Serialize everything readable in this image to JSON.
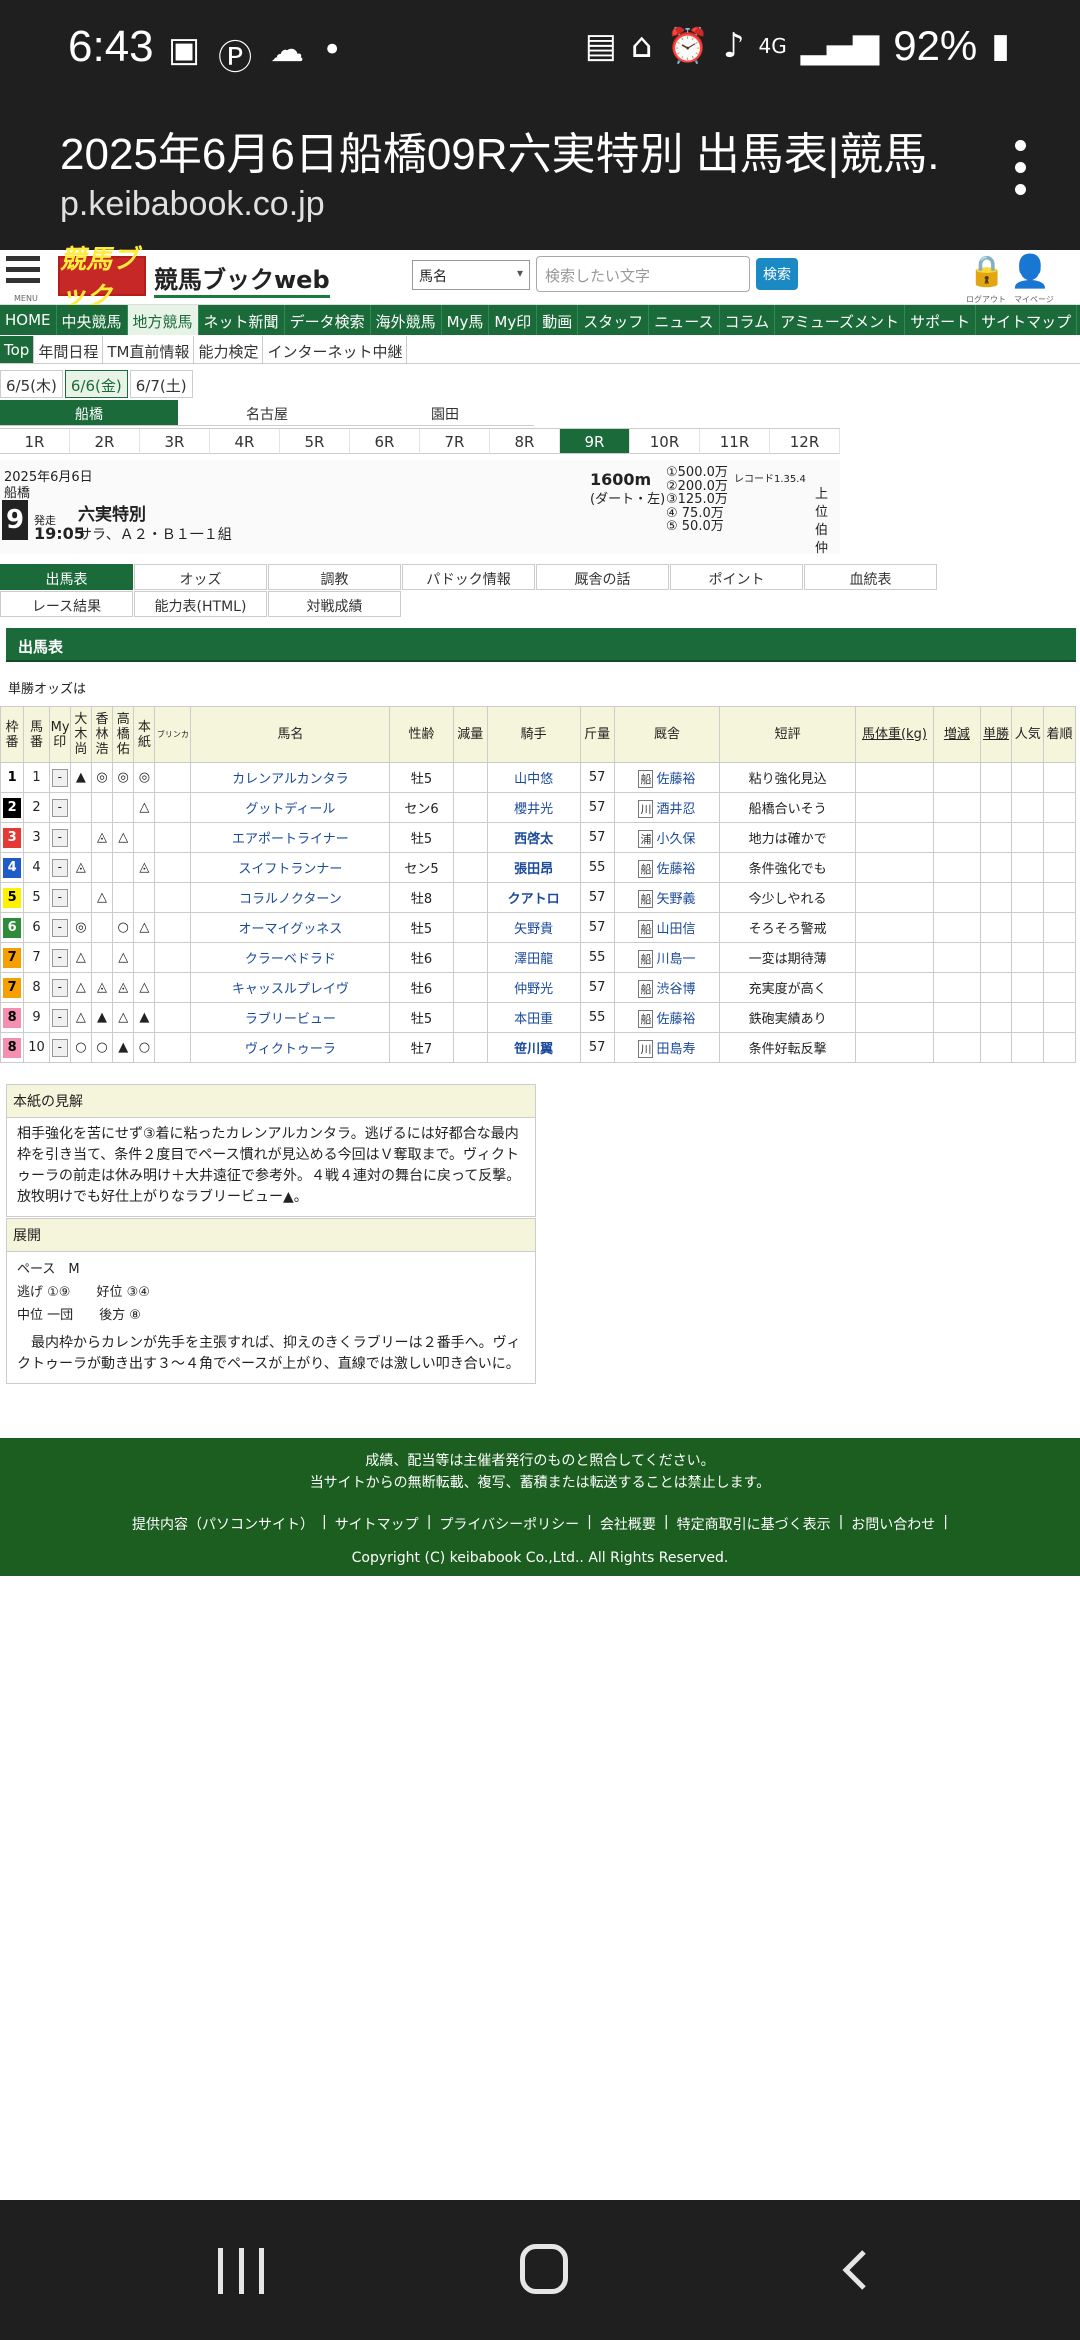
{
  "status": {
    "time": "6:43",
    "battery": "92%",
    "network": "4G"
  },
  "browser": {
    "title": "2025年6月6日船橋09R六実特別 出馬表|競馬...",
    "url": "p.keibabook.co.jp"
  },
  "header": {
    "logo": "競馬ブック",
    "site_name": "競馬ブックweb",
    "search_select": "馬名",
    "search_placeholder": "検索したい文字",
    "search_button": "検索",
    "menu_label": "MENU",
    "logout_label": "ログアウト",
    "mypage_label": "マイページ"
  },
  "nav1": [
    "HOME",
    "中央競馬",
    "地方競馬",
    "ネット新聞",
    "データ検索",
    "海外競馬",
    "My馬",
    "My印",
    "動画",
    "スタッフ",
    "ニュース",
    "コラム",
    "アミューズメント",
    "サポート",
    "サイトマップ"
  ],
  "nav2": [
    "Top",
    "年間日程",
    "TM直前情報",
    "能力検定",
    "インターネット中継"
  ],
  "dates": [
    "6/5(木)",
    "6/6(金)",
    "6/7(土)"
  ],
  "venues": [
    "船橋",
    "名古屋",
    "園田"
  ],
  "races": [
    "1R",
    "2R",
    "3R",
    "4R",
    "5R",
    "6R",
    "7R",
    "8R",
    "9R",
    "10R",
    "11R",
    "12R"
  ],
  "race": {
    "date": "2025年6月6日",
    "venue": "船橋",
    "number": "9",
    "hassou": "発走",
    "time": "19:05",
    "name": "六実特別",
    "class": "サラ、Ａ２・Ｂ１一１組",
    "distance": "1600m",
    "course": "(ダート・左)",
    "prizes": [
      "①500.0万",
      "②200.0万",
      "③125.0万",
      "④ 75.0万",
      "⑤ 50.0万"
    ],
    "record": "レコード1.35.4",
    "side": "上位伯仲"
  },
  "tabs": [
    "出馬表",
    "オッズ",
    "調教",
    "パドック情報",
    "厩舎の話",
    "ポイント",
    "血統表",
    "レース結果",
    "能力表(HTML)",
    "対戦成績"
  ],
  "section_title": "出馬表",
  "odds_note": "単勝オッズは",
  "table": {
    "headers": [
      "枠番",
      "馬番",
      "My印",
      "大木尚",
      "香林浩",
      "高橋佑",
      "本紙",
      "ブリンカ",
      "馬名",
      "性齢",
      "減量",
      "騎手",
      "斤量",
      "厩舎",
      "短評",
      "馬体重(kg)",
      "増減",
      "単勝",
      "人気",
      "着順"
    ],
    "rows": [
      {
        "waku": "1",
        "num": "1",
        "my": "-",
        "m1": "▲",
        "m2": "◎",
        "m3": "◎",
        "m4": "◎",
        "name": "カレンアルカンタラ",
        "sex": "牡5",
        "jockey": "山中悠",
        "weight": "57",
        "area": "船",
        "trainer": "佐藤裕",
        "comment": "粘り強化見込"
      },
      {
        "waku": "2",
        "num": "2",
        "my": "-",
        "m1": "",
        "m2": "",
        "m3": "",
        "m4": "△",
        "name": "グットディール",
        "sex": "セン6",
        "jockey": "櫻井光",
        "weight": "57",
        "area": "川",
        "trainer": "酒井忍",
        "comment": "船橋合いそう"
      },
      {
        "waku": "3",
        "num": "3",
        "my": "-",
        "m1": "",
        "m2": "◬",
        "m3": "△",
        "m4": "",
        "name": "エアポートライナー",
        "sex": "牡5",
        "jockey": "西啓太",
        "weight": "57",
        "area": "浦",
        "trainer": "小久保",
        "comment": "地力は確かで"
      },
      {
        "waku": "4",
        "num": "4",
        "my": "-",
        "m1": "◬",
        "m2": "",
        "m3": "",
        "m4": "◬",
        "name": "スイフトランナー",
        "sex": "セン5",
        "jockey": "張田昂",
        "weight": "55",
        "area": "船",
        "trainer": "佐藤裕",
        "comment": "条件強化でも"
      },
      {
        "waku": "5",
        "num": "5",
        "my": "-",
        "m1": "",
        "m2": "△",
        "m3": "",
        "m4": "",
        "name": "コラルノクターン",
        "sex": "牡8",
        "jockey": "クアトロ",
        "weight": "57",
        "area": "船",
        "trainer": "矢野義",
        "comment": "今少しやれる"
      },
      {
        "waku": "6",
        "num": "6",
        "my": "-",
        "m1": "◎",
        "m2": "",
        "m3": "○",
        "m4": "△",
        "name": "オーマイグッネス",
        "sex": "牡5",
        "jockey": "矢野貴",
        "weight": "57",
        "area": "船",
        "trainer": "山田信",
        "comment": "そろそろ警戒"
      },
      {
        "waku": "7",
        "num": "7",
        "my": "-",
        "m1": "△",
        "m2": "",
        "m3": "△",
        "m4": "",
        "name": "クラーベドラド",
        "sex": "牡6",
        "jockey": "澤田龍",
        "weight": "55",
        "area": "船",
        "trainer": "川島一",
        "comment": "一変は期待薄"
      },
      {
        "waku": "7",
        "num": "8",
        "my": "-",
        "m1": "△",
        "m2": "◬",
        "m3": "◬",
        "m4": "△",
        "name": "キャッスルプレイヴ",
        "sex": "牡6",
        "jockey": "仲野光",
        "weight": "57",
        "area": "船",
        "trainer": "渋谷博",
        "comment": "充実度が高く"
      },
      {
        "waku": "8",
        "num": "9",
        "my": "-",
        "m1": "△",
        "m2": "▲",
        "m3": "△",
        "m4": "▲",
        "name": "ラブリービュー",
        "sex": "牡5",
        "jockey": "本田重",
        "weight": "55",
        "area": "船",
        "trainer": "佐藤裕",
        "comment": "鉄砲実績あり"
      },
      {
        "waku": "8",
        "num": "10",
        "my": "-",
        "m1": "○",
        "m2": "○",
        "m3": "▲",
        "m4": "○",
        "name": "ヴィクトゥーラ",
        "sex": "牡7",
        "jockey": "笹川翼",
        "weight": "57",
        "area": "川",
        "trainer": "田島寿",
        "comment": "条件好転反撃"
      }
    ]
  },
  "colors": {
    "waku": {
      "1": "#ffffff",
      "2": "#000000",
      "3": "#e53935",
      "4": "#1e5bc6",
      "5": "#fff200",
      "6": "#2e8b3a",
      "7": "#f59f00",
      "8": "#f48fb1"
    },
    "accent": "#1b6b3a"
  },
  "view": {
    "title": "本紙の見解",
    "text": "相手強化を苦にせず③着に粘ったカレンアルカンタラ。逃げるには好都合な最内枠を引き当て、条件２度目でペース慣れが見込める今回はＶ奪取まで。ヴィクトゥーラの前走は休み明け＋大井遠征で参考外。４戦４連対の舞台に戻って反撃。放牧明けでも好仕上がりなラブリービュー▲。"
  },
  "tenkai": {
    "title": "展開",
    "pace": "ペース　M",
    "nige": "逃げ ①⑨　　好位 ③④",
    "chui": "中位 一団　　後方 ⑧",
    "text": "　最内枠からカレンが先手を主張すれば、抑えのきくラブリーは２番手へ。ヴィクトゥーラが動き出す３～４角でペースが上がり、直線では激しい叩き合いに。"
  },
  "footer": {
    "line1": "成績、配当等は主催者発行のものと照合してください。",
    "line2": "当サイトからの無断転載、複写、蓄積または転送することは禁止します。",
    "links": [
      "提供内容（パソコンサイト）",
      "サイトマップ",
      "プライバシーポリシー",
      "会社概要",
      "特定商取引に基づく表示",
      "お問い合わせ"
    ],
    "copyright": "Copyright (C) keibabook Co.,Ltd.. All Rights Reserved."
  }
}
